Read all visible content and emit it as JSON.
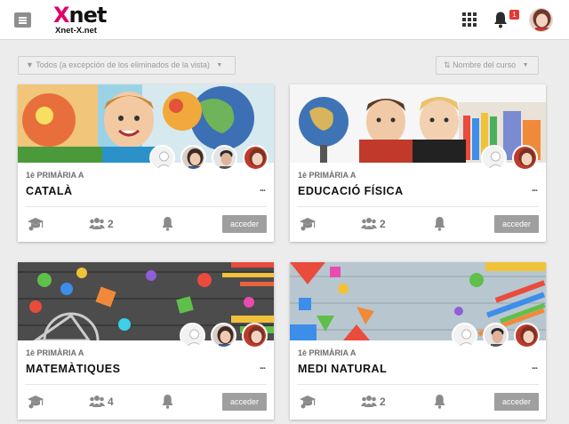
{
  "app": {
    "logo_main_x": "X",
    "logo_main_rest": "net",
    "logo_sub": "Xnet-X.net",
    "notification_count": "1",
    "accent_color": "#e0006a"
  },
  "filters": {
    "view_filter_label": "Todos (a excepción de los eliminados de la vista)",
    "sort_label": "Nombre del curso"
  },
  "courses": [
    {
      "grade": "1è PRIMÀRIA A",
      "title": "CATALÀ",
      "members": "",
      "access_label": "acceder",
      "more_label": "..."
    },
    {
      "grade": "1è PRIMÀRIA A",
      "title": "EDUCACIÓ FÍSICA",
      "members": "2",
      "access_label": "acceder",
      "more_label": "..."
    },
    {
      "grade": "1è PRIMÀRIA A",
      "title": "MATEMÀTIQUES",
      "members": "4",
      "access_label": "acceder",
      "more_label": "..."
    },
    {
      "grade": "1è PRIMÀRIA A",
      "title": "MEDI NATURAL",
      "members": "2",
      "access_label": "acceder",
      "more_label": "..."
    }
  ],
  "card0_members": "2",
  "icons": [
    "menu-icon",
    "apps-grid-icon",
    "bell-icon",
    "user-avatar",
    "filter-icon",
    "sort-icon",
    "graduation-cap-icon",
    "users-icon",
    "bell-icon"
  ]
}
